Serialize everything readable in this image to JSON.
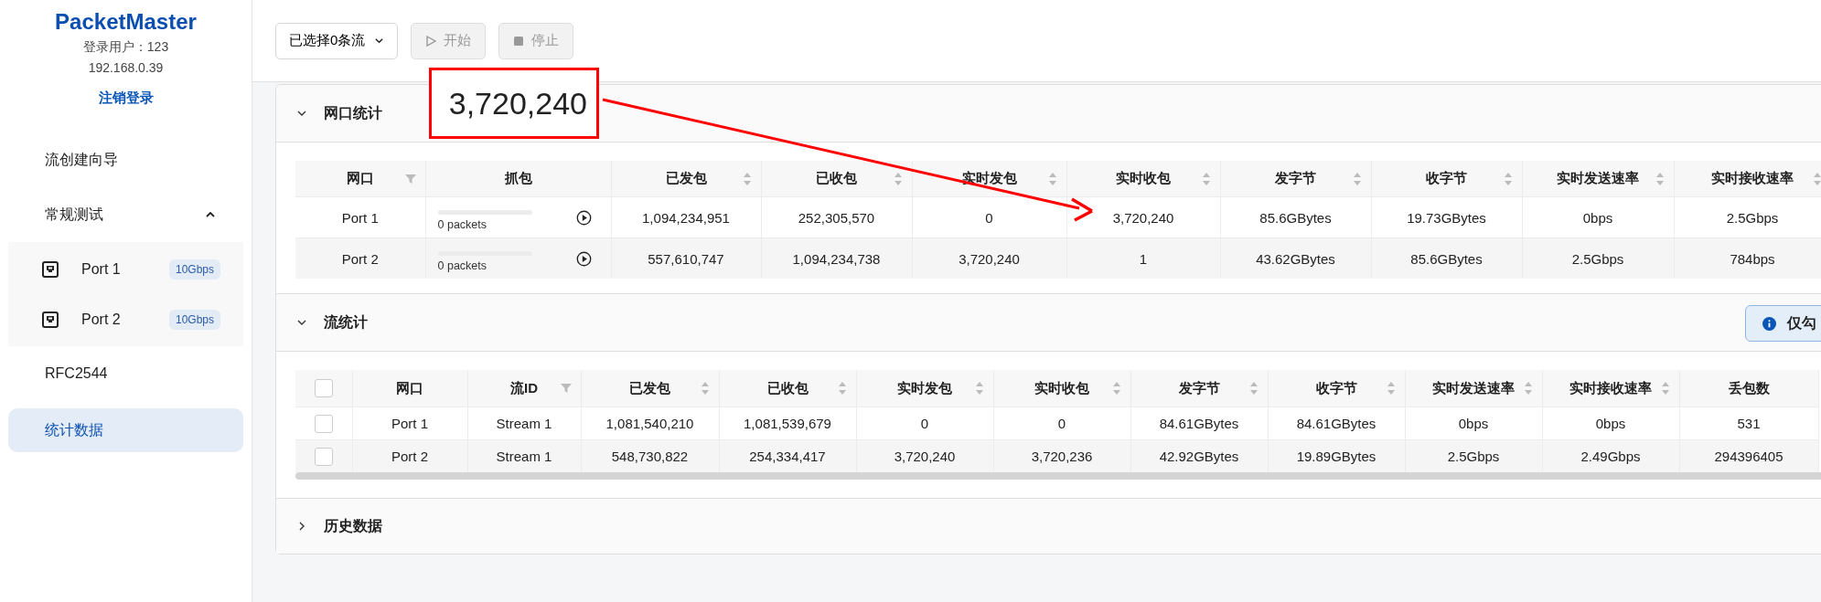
{
  "sidebar": {
    "logo": "PacketMaster",
    "user": "登录用户：123",
    "ip": "192.168.0.39",
    "logout": "注销登录",
    "items": [
      {
        "kind": "link",
        "label": "流创建向导",
        "selected": false
      },
      {
        "kind": "group",
        "label": "常规测试",
        "expanded": true,
        "selected": false,
        "children": [
          {
            "label": "Port 1",
            "badge": "10Gbps",
            "selected": false
          },
          {
            "label": "Port 2",
            "badge": "10Gbps",
            "selected": false
          }
        ]
      },
      {
        "kind": "link",
        "label": "RFC2544",
        "selected": false
      },
      {
        "kind": "link",
        "label": "统计数据",
        "selected": true
      }
    ]
  },
  "toolbar": {
    "stream_select": "已选择0条流",
    "buttons": [
      {
        "kind": "play",
        "label": "开始",
        "disabled": true
      },
      {
        "kind": "stop",
        "label": "停止",
        "disabled": true
      }
    ]
  },
  "annotation": {
    "text": "3,720,240"
  },
  "port_stats": {
    "title": "网口统计",
    "expanded": true,
    "columns": [
      {
        "label": "网口",
        "sortable": false,
        "filter": true
      },
      {
        "label": "抓包",
        "sortable": false,
        "filter": false
      },
      {
        "label": "已发包",
        "sortable": true,
        "filter": false
      },
      {
        "label": "已收包",
        "sortable": true,
        "filter": false
      },
      {
        "label": "实时发包",
        "sortable": true,
        "filter": false
      },
      {
        "label": "实时收包",
        "sortable": true,
        "filter": false
      },
      {
        "label": "发字节",
        "sortable": true,
        "filter": false
      },
      {
        "label": "收字节",
        "sortable": true,
        "filter": false
      },
      {
        "label": "实时发送速率",
        "sortable": true,
        "filter": false
      },
      {
        "label": "实时接收速率",
        "sortable": true,
        "filter": false
      }
    ],
    "rows": [
      {
        "port": "Port 1",
        "capture": {
          "level": 0,
          "text": "0 packets"
        },
        "values": [
          "1,094,234,951",
          "252,305,570",
          "0",
          "3,720,240",
          "85.6GBytes",
          "19.73GBytes",
          "0bps",
          "2.5Gbps"
        ]
      },
      {
        "port": "Port 2",
        "capture": {
          "level": 0,
          "text": "0 packets"
        },
        "values": [
          "557,610,747",
          "1,094,234,738",
          "3,720,240",
          "1",
          "43.62GBytes",
          "85.6GBytes",
          "2.5Gbps",
          "784bps"
        ]
      }
    ]
  },
  "flow_stats": {
    "title": "流统计",
    "expanded": true,
    "notice": "仅勾",
    "header_checked": false,
    "columns": [
      {
        "label": "网口",
        "sortable": false,
        "filter": false
      },
      {
        "label": "流ID",
        "sortable": false,
        "filter": true
      },
      {
        "label": "已发包",
        "sortable": true,
        "filter": false
      },
      {
        "label": "已收包",
        "sortable": true,
        "filter": false
      },
      {
        "label": "实时发包",
        "sortable": true,
        "filter": false
      },
      {
        "label": "实时收包",
        "sortable": true,
        "filter": false
      },
      {
        "label": "发字节",
        "sortable": true,
        "filter": false
      },
      {
        "label": "收字节",
        "sortable": true,
        "filter": false
      },
      {
        "label": "实时发送速率",
        "sortable": true,
        "filter": false
      },
      {
        "label": "实时接收速率",
        "sortable": true,
        "filter": false
      },
      {
        "label": "丢包数",
        "sortable": false,
        "filter": false
      }
    ],
    "rows": [
      {
        "checked": false,
        "cells": [
          "Port 1",
          "Stream 1",
          "1,081,540,210",
          "1,081,539,679",
          "0",
          "0",
          "84.61GBytes",
          "84.61GBytes",
          "0bps",
          "0bps",
          "531"
        ]
      },
      {
        "checked": false,
        "cells": [
          "Port 2",
          "Stream 1",
          "548,730,822",
          "254,334,417",
          "3,720,240",
          "3,720,236",
          "42.92GBytes",
          "19.89GBytes",
          "2.5Gbps",
          "2.49Gbps",
          "294396405"
        ]
      }
    ]
  },
  "history": {
    "title": "历史数据",
    "expanded": false
  }
}
